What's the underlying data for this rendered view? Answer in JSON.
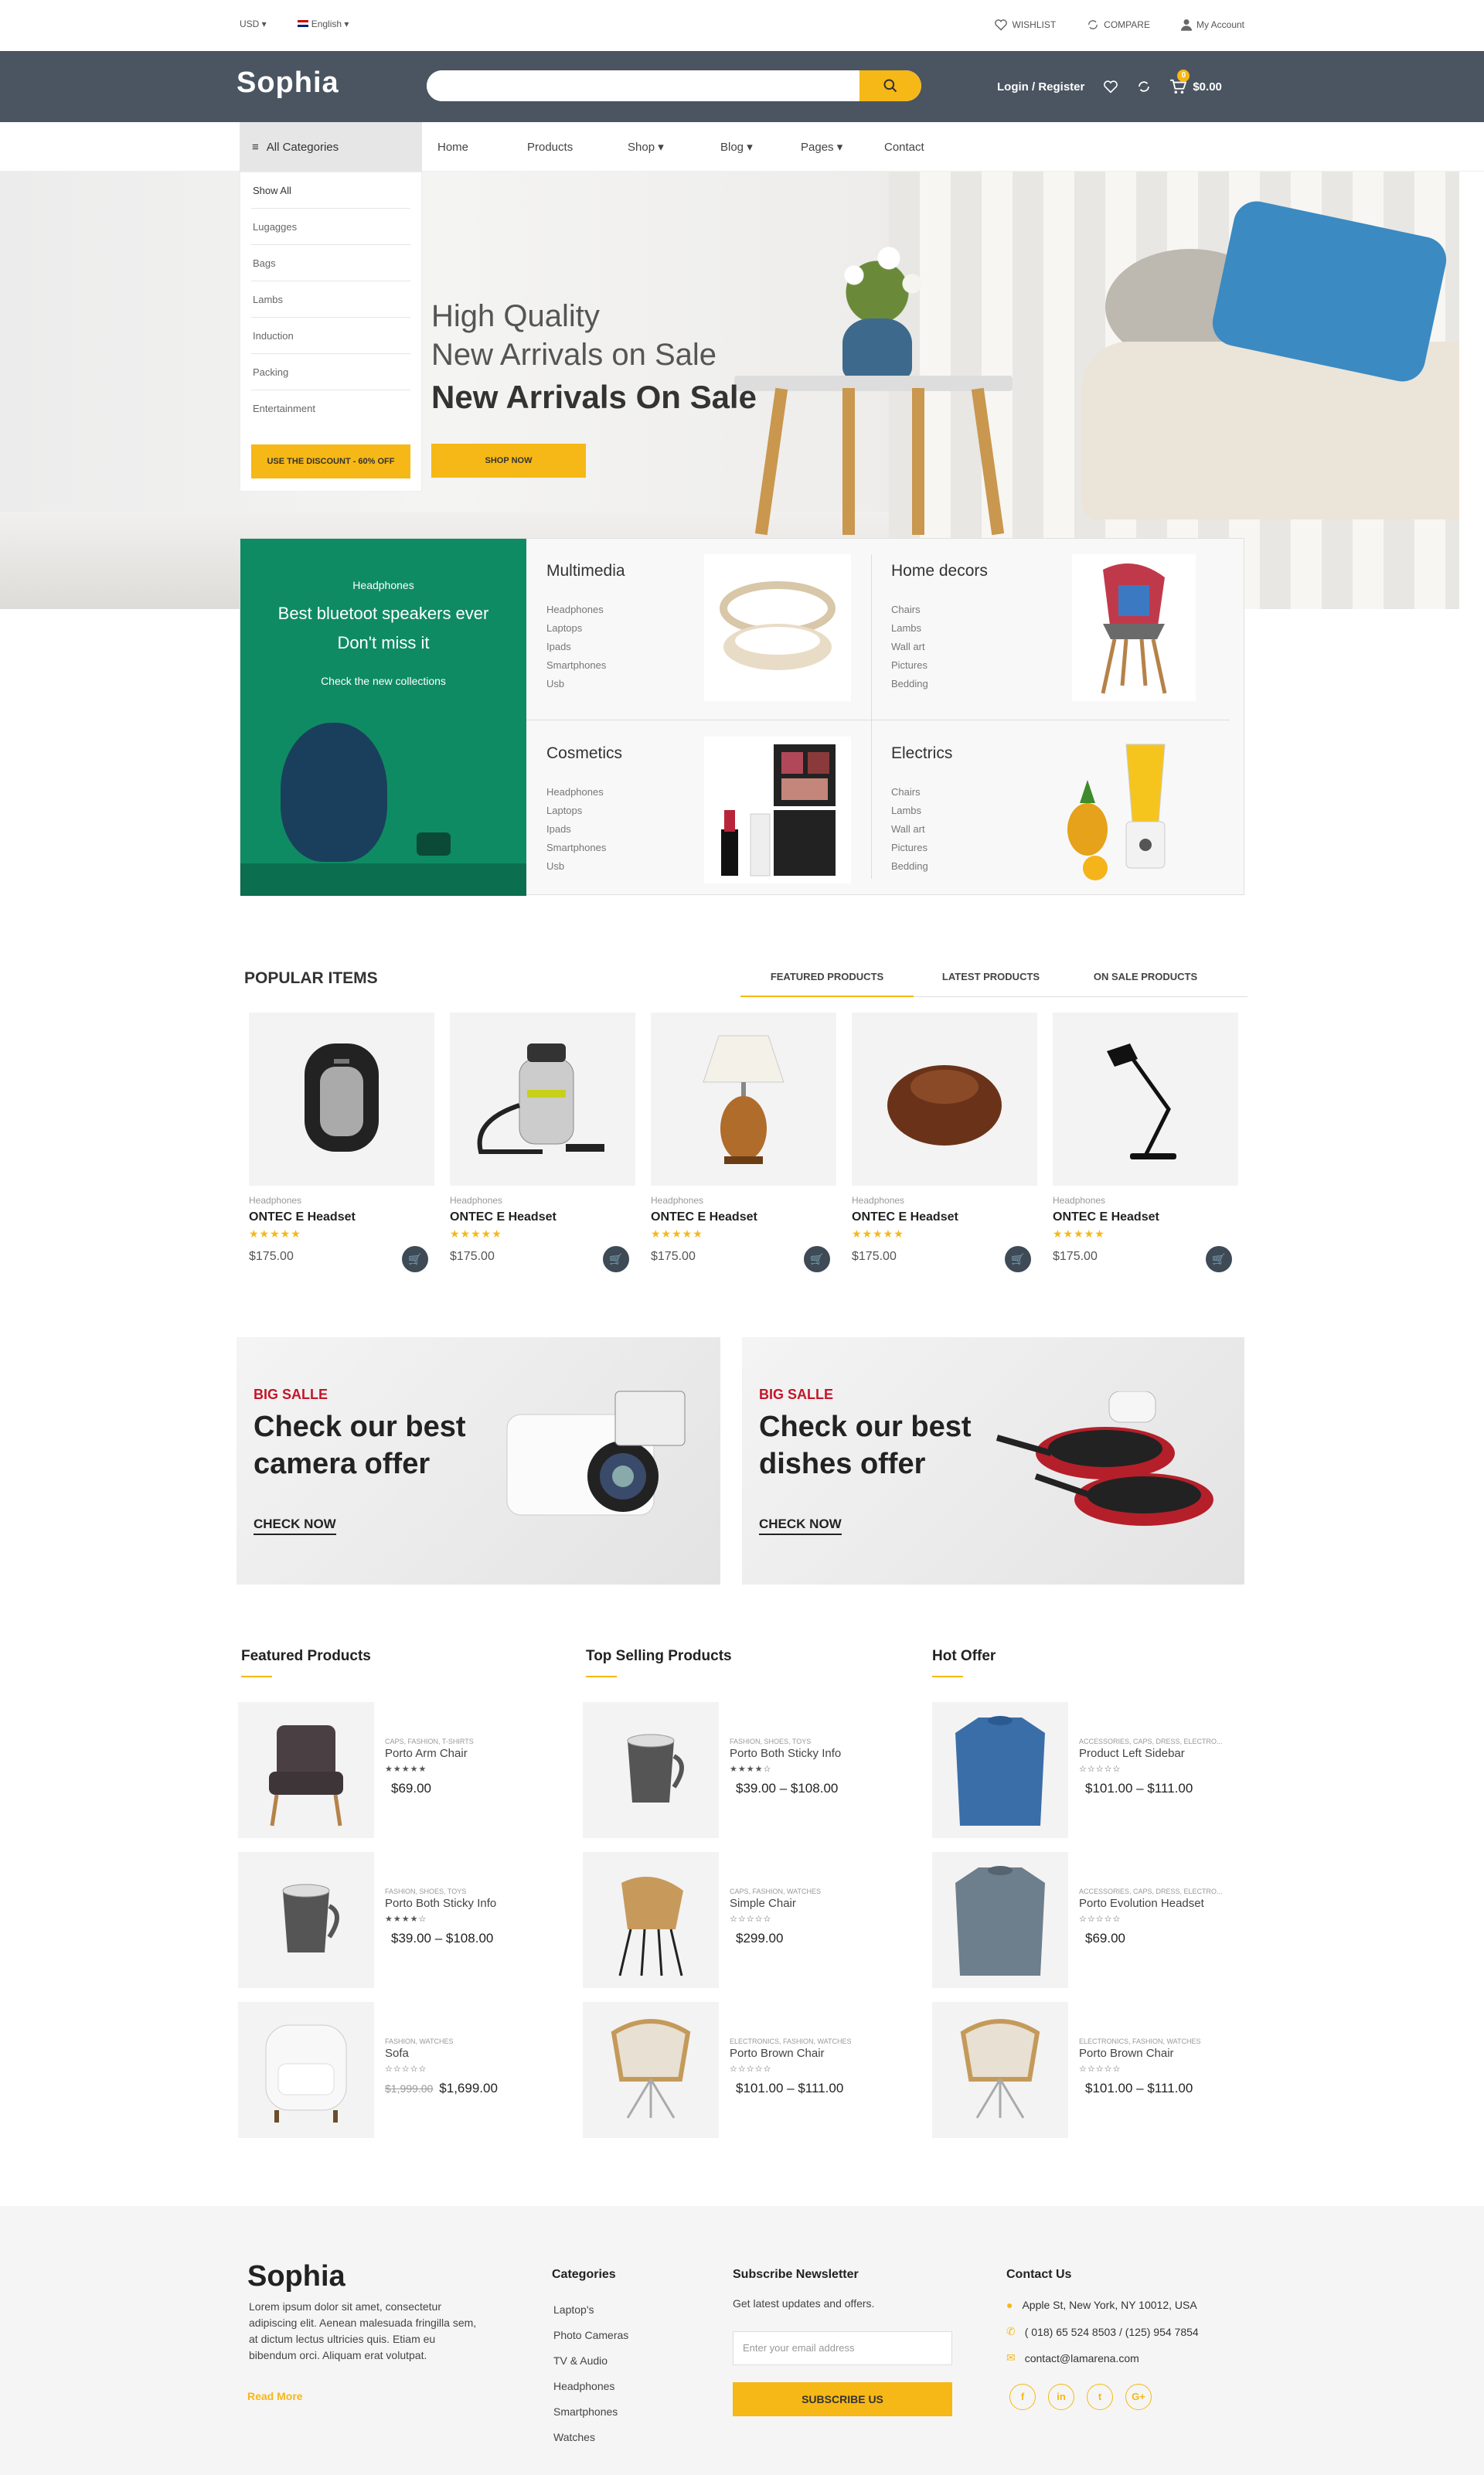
{
  "topbar": {
    "currency": "USD ▾",
    "language": "English ▾",
    "wishlist": "WISHLIST",
    "compare": "COMPARE",
    "account": "My Account"
  },
  "header": {
    "logo": "Sophia",
    "search_placeholder": "",
    "login": "Login / Register",
    "cart_count": "0",
    "cart_total": "$0.00"
  },
  "nav": {
    "categories_label": "All Categories",
    "links": [
      "Home",
      "Products",
      "Shop ▾",
      "Blog ▾",
      "Pages ▾",
      "Contact"
    ]
  },
  "category_menu": {
    "items": [
      "Show All",
      "Lugagges",
      "Bags",
      "Lambs",
      "Induction",
      "Packing",
      "Entertainment"
    ],
    "discount_button": "USE THE DISCOUNT - 60% OFF"
  },
  "hero": {
    "line1": "High Quality",
    "line2": "New Arrivals on Sale",
    "line3": "New Arrivals On Sale",
    "button": "SHOP NOW"
  },
  "promo": {
    "subtitle": "Headphones",
    "headline1": "Best bluetoot speakers ever",
    "headline2": "Don't miss it",
    "link": "Check the new collections"
  },
  "categories": [
    {
      "title": "Multimedia",
      "items": [
        "Headphones",
        "Laptops",
        "Ipads",
        "Smartphones",
        "Usb"
      ]
    },
    {
      "title": "Home decors",
      "items": [
        "Chairs",
        "Lambs",
        "Wall art",
        "Pictures",
        "Bedding"
      ]
    },
    {
      "title": "Cosmetics",
      "items": [
        "Headphones",
        "Laptops",
        "Ipads",
        "Smartphones",
        "Usb"
      ]
    },
    {
      "title": "Electrics",
      "items": [
        "Chairs",
        "Lambs",
        "Wall art",
        "Pictures",
        "Bedding"
      ]
    }
  ],
  "popular": {
    "title": "POPULAR ITEMS",
    "tabs": [
      "FEATURED PRODUCTS",
      "LATEST PRODUCTS",
      "ON SALE PRODUCTS"
    ],
    "products": [
      {
        "category": "Headphones",
        "name": "ONTEC E Headset",
        "stars": "★★★★★",
        "price": "$175.00"
      },
      {
        "category": "Headphones",
        "name": "ONTEC E Headset",
        "stars": "★★★★★",
        "price": "$175.00"
      },
      {
        "category": "Headphones",
        "name": "ONTEC E Headset",
        "stars": "★★★★★",
        "price": "$175.00"
      },
      {
        "category": "Headphones",
        "name": "ONTEC E Headset",
        "stars": "★★★★★",
        "price": "$175.00"
      },
      {
        "category": "Headphones",
        "name": "ONTEC E Headset",
        "stars": "★★★★★",
        "price": "$175.00"
      }
    ]
  },
  "banners": [
    {
      "tag": "BIG SALLE",
      "line1": "Check our best",
      "line2": "camera offer",
      "link": "CHECK NOW"
    },
    {
      "tag": "BIG SALLE",
      "line1": "Check our best",
      "line2": "dishes offer",
      "link": "CHECK NOW"
    }
  ],
  "lists": [
    {
      "title": "Featured Products",
      "items": [
        {
          "cats": "CAPS, FASHION, T-SHIRTS",
          "name": "Porto Arm Chair",
          "stars": "★★★★★",
          "price": "$69.00",
          "old": ""
        },
        {
          "cats": "FASHION, SHOES, TOYS",
          "name": "Porto Both Sticky Info",
          "stars": "★★★★☆",
          "price": "$39.00 – $108.00",
          "old": ""
        },
        {
          "cats": "FASHION, WATCHES",
          "name": "Sofa",
          "stars": "☆☆☆☆☆",
          "price": "$1,699.00",
          "old": "$1,999.00"
        }
      ]
    },
    {
      "title": "Top Selling Products",
      "items": [
        {
          "cats": "FASHION, SHOES, TOYS",
          "name": "Porto Both Sticky Info",
          "stars": "★★★★☆",
          "price": "$39.00 – $108.00",
          "old": ""
        },
        {
          "cats": "CAPS, FASHION, WATCHES",
          "name": "Simple Chair",
          "stars": "☆☆☆☆☆",
          "price": "$299.00",
          "old": ""
        },
        {
          "cats": "ELECTRONICS, FASHION, WATCHES",
          "name": "Porto Brown Chair",
          "stars": "☆☆☆☆☆",
          "price": "$101.00 – $111.00",
          "old": ""
        }
      ]
    },
    {
      "title": "Hot Offer",
      "items": [
        {
          "cats": "ACCESSORIES, CAPS, DRESS, ELECTRO...",
          "name": "Product Left Sidebar",
          "stars": "☆☆☆☆☆",
          "price": "$101.00 – $111.00",
          "old": ""
        },
        {
          "cats": "ACCESSORIES, CAPS, DRESS, ELECTRO...",
          "name": "Porto Evolution Headset",
          "stars": "☆☆☆☆☆",
          "price": "$69.00",
          "old": ""
        },
        {
          "cats": "ELECTRONICS, FASHION, WATCHES",
          "name": "Porto Brown Chair",
          "stars": "☆☆☆☆☆",
          "price": "$101.00 – $111.00",
          "old": ""
        }
      ]
    }
  ],
  "footer": {
    "logo": "Sophia",
    "about": "Lorem ipsum dolor sit amet, consectetur adipiscing elit. Aenean malesuada fringilla sem, at dictum lectus ultricies quis. Etiam eu bibendum orci. Aliquam erat volutpat.",
    "read_more": "Read More",
    "categories_title": "Categories",
    "categories": [
      "Laptop's",
      "Photo Cameras",
      "TV & Audio",
      "Headphones",
      "Smartphones",
      "Watches"
    ],
    "newsletter_title": "Subscribe Newsletter",
    "newsletter_text": "Get latest updates and offers.",
    "email_placeholder": "Enter your email address",
    "subscribe": "SUBSCRIBE US",
    "contact_title": "Contact Us",
    "address": "Apple St, New York, NY 10012, USA",
    "phone": "( 018) 65 524 8503 / (125) 954 7854",
    "email": "contact@lamarena.com",
    "social": [
      "f",
      "in",
      "t",
      "G+"
    ]
  },
  "colors": {
    "accent": "#f6b816",
    "header": "#4a5561",
    "promo": "#0f8b63",
    "sale": "#c2162a"
  }
}
